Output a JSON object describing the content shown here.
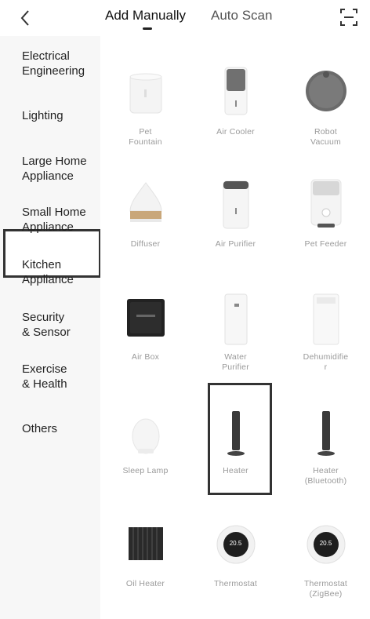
{
  "header": {
    "active_tab": "Add Manually",
    "inactive_tab": "Auto Scan"
  },
  "sidebar": {
    "items": [
      {
        "label": "Electrical\nEngineering"
      },
      {
        "label": "Lighting"
      },
      {
        "label": "Large Home\nAppliance"
      },
      {
        "label": "Small Home\nAppliance"
      },
      {
        "label": "Kitchen\nAppliance"
      },
      {
        "label": "Security\n& Sensor"
      },
      {
        "label": "Exercise\n& Health"
      },
      {
        "label": "Others"
      }
    ],
    "selected": "Small Home\nAppliance"
  },
  "devices": [
    {
      "label": "Pet\nFountain",
      "icon": "pet-fountain-icon"
    },
    {
      "label": "Air Cooler",
      "icon": "air-cooler-icon"
    },
    {
      "label": "Robot\nVacuum",
      "icon": "robot-vacuum-icon"
    },
    {
      "label": "Diffuser",
      "icon": "diffuser-icon"
    },
    {
      "label": "Air Purifier",
      "icon": "air-purifier-icon"
    },
    {
      "label": "Pet Feeder",
      "icon": "pet-feeder-icon"
    },
    {
      "label": "Air Box",
      "icon": "air-box-icon"
    },
    {
      "label": "Water\nPurifier",
      "icon": "water-purifier-icon"
    },
    {
      "label": "Dehumidifie\nr",
      "icon": "dehumidifier-icon"
    },
    {
      "label": "Sleep Lamp",
      "icon": "sleep-lamp-icon"
    },
    {
      "label": "Heater",
      "icon": "heater-icon"
    },
    {
      "label": "Heater\n(Bluetooth)",
      "icon": "heater-bluetooth-icon"
    },
    {
      "label": "Oil Heater",
      "icon": "oil-heater-icon"
    },
    {
      "label": "Thermostat",
      "icon": "thermostat-icon",
      "display": "20.5"
    },
    {
      "label": "Thermostat\n(ZigBee)",
      "icon": "thermostat-zigbee-icon",
      "display": "20.5"
    }
  ]
}
